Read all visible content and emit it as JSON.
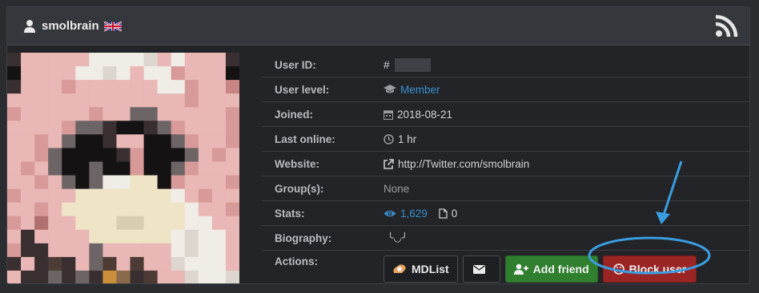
{
  "header": {
    "username": "smolbrain",
    "user_icon": "user-icon",
    "flag_icon": "uk-flag-icon",
    "rss_icon": "rss-icon"
  },
  "profile": {
    "rows": {
      "user_id": {
        "label": "User ID:",
        "prefix": "#",
        "value": ""
      },
      "user_level": {
        "label": "User level:",
        "value": "Member",
        "icon": "graduation-cap-icon"
      },
      "joined": {
        "label": "Joined:",
        "value": "2018-08-21",
        "icon": "calendar-icon"
      },
      "last_online": {
        "label": "Last online:",
        "value": "1 hr",
        "icon": "clock-icon"
      },
      "website": {
        "label": "Website:",
        "value": "http://Twitter.com/smolbrain",
        "icon": "external-link-icon"
      },
      "groups": {
        "label": "Group(s):",
        "value": "None"
      },
      "stats": {
        "label": "Stats:",
        "views": "1,629",
        "uploads": "0",
        "icons": [
          "eye-icon",
          "file-icon"
        ]
      },
      "biography": {
        "label": "Biography:",
        "value": "╰◡╯"
      },
      "actions": {
        "label": "Actions:"
      }
    }
  },
  "actions": {
    "mdlist": "MDList",
    "message_icon": "envelope-icon",
    "add_friend": "Add friend",
    "block_user": "Block user"
  },
  "colors": {
    "link": "#3b8fd0",
    "add_friend_bg": "#2f7f2f",
    "block_bg": "#9b2425",
    "annotation": "#3a9de0"
  }
}
